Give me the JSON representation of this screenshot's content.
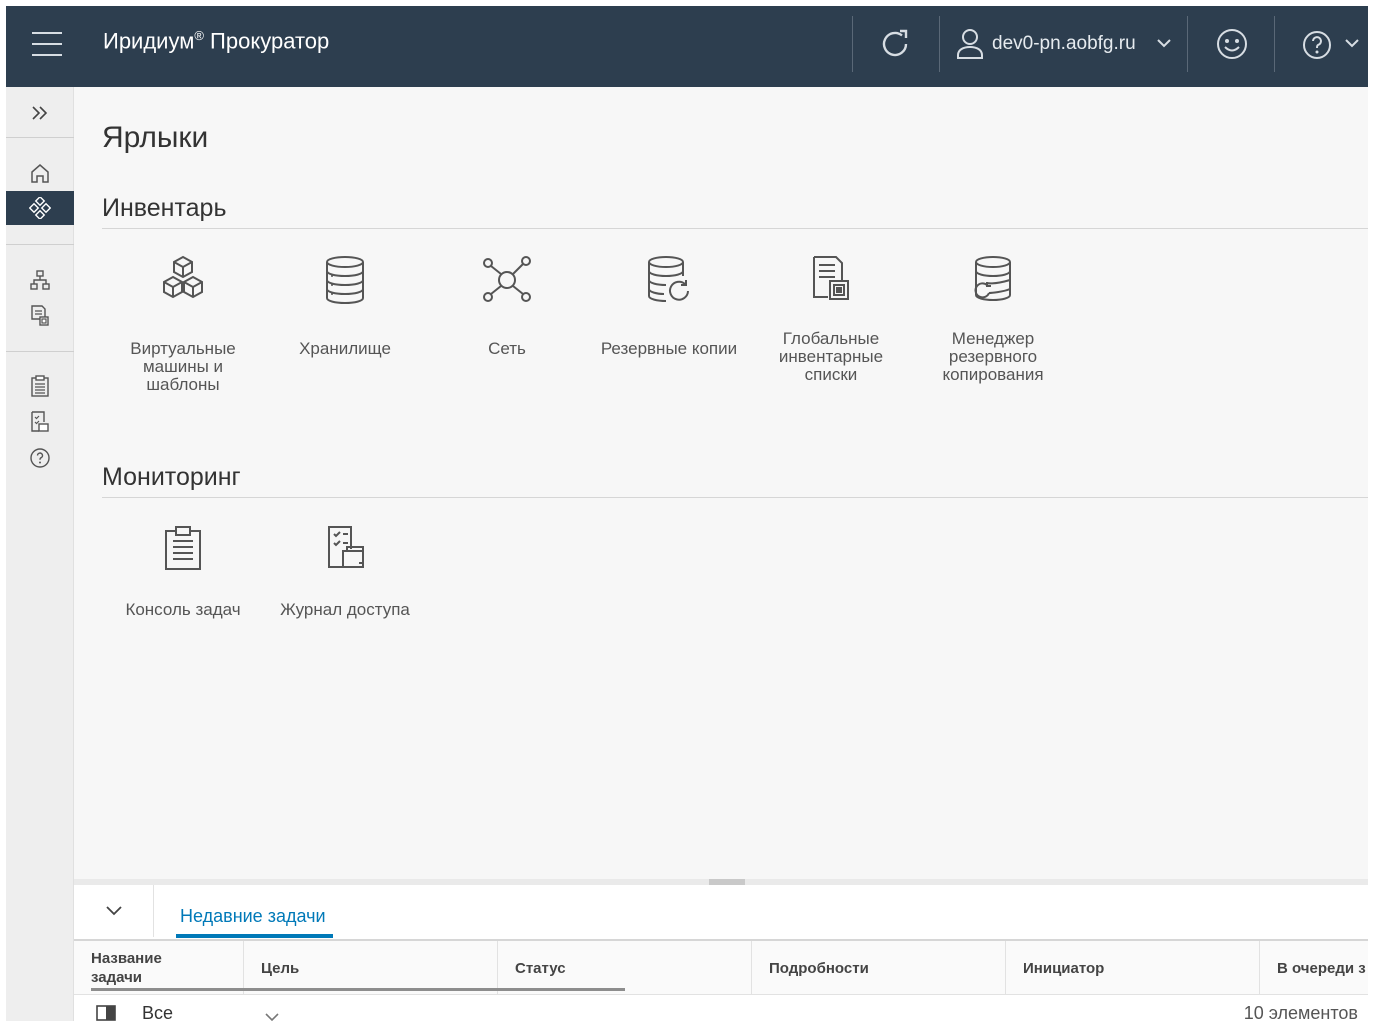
{
  "header": {
    "brand": "Иридиум",
    "reg_mark": "®",
    "product": " Прокуратор",
    "user": "dev0-pn.aobfg.ru"
  },
  "main": {
    "title": "Ярлыки",
    "inventory": {
      "title": "Инвентарь",
      "items": [
        {
          "label": "Виртуальные машины и шаблоны",
          "icon": "vms-templates-icon"
        },
        {
          "label": "Хранилище",
          "icon": "storage-icon"
        },
        {
          "label": "Сеть",
          "icon": "network-icon"
        },
        {
          "label": "Резервные копии",
          "icon": "backups-icon"
        },
        {
          "label": "Глобальные инвентарные списки",
          "icon": "global-inventory-icon"
        },
        {
          "label": "Менеджер резервного копирования",
          "icon": "backup-manager-icon"
        }
      ]
    },
    "monitoring": {
      "title": "Мониторинг",
      "items": [
        {
          "label": "Консоль задач",
          "icon": "task-console-icon"
        },
        {
          "label": "Журнал доступа",
          "icon": "access-log-icon"
        }
      ]
    }
  },
  "bottom_panel": {
    "tab": "Недавние задачи",
    "columns": [
      "Название задачи",
      "Цель",
      "Статус",
      "Подробности",
      "Инициатор",
      "В очереди з"
    ],
    "filter": "Все",
    "count": "10 элементов"
  },
  "colors": {
    "header_bg": "#2d3e4f",
    "accent": "#0079b8",
    "sidebar_active": "#2d3e4f"
  }
}
